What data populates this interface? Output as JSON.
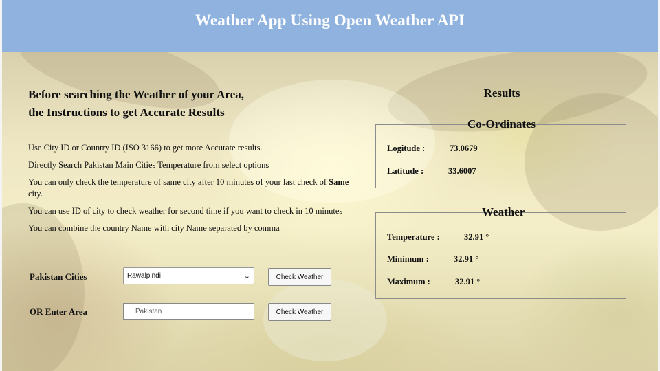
{
  "header": {
    "title": "Weather App Using Open Weather API"
  },
  "instructions": {
    "title_line1": "Before searching the Weather of your Area,",
    "title_line2": "the Instructions to get Accurate Results",
    "items": [
      "Use City ID or Country ID (ISO 3166) to get more Accurate results.",
      "Directly Search Pakistan Main Cities Temperature from select options",
      "You can only check the temperature of same city after 10 minutes of your last check of",
      "Same",
      "city.",
      "You can use ID of city to check weather for second time if you want to check in 10 minutes",
      "You can combine the country Name with city Name separated by comma"
    ]
  },
  "form": {
    "cities_label": "Pakistan Cities",
    "cities_selected": "Rawalpindi",
    "area_label": "OR Enter Area",
    "area_placeholder": "Pakistan",
    "check_button_1": "Check Weather",
    "check_button_2": "Check Weather"
  },
  "results": {
    "title": "Results",
    "coordinates": {
      "legend": "Co-Ordinates",
      "longitude_label": "Logitude :",
      "longitude_value": "73.0679",
      "latitude_label": "Latitude :",
      "latitude_value": "33.6007"
    },
    "weather": {
      "legend": "Weather",
      "temperature_label": "Temperature :",
      "temperature_value": "32.91 °",
      "minimum_label": "Minimum :",
      "minimum_value": "32.91 °",
      "maximum_label": "Maximum :",
      "maximum_value": "32.91 °"
    }
  },
  "icons": {
    "select_chevron": "chevron-down-icon"
  },
  "colors": {
    "header": "#8fb3de",
    "header_text": "#ffffff"
  }
}
